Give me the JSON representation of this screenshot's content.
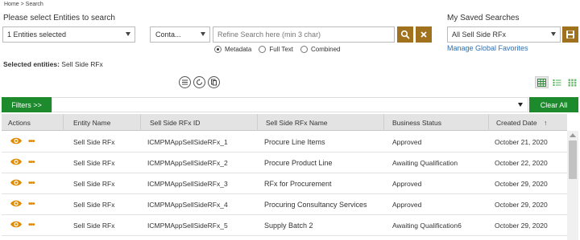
{
  "breadcrumb": "Home > Search",
  "search": {
    "prompt": "Please select Entities to search",
    "entities_value": "1 Entities selected",
    "condition_value": "Conta...",
    "query_placeholder": "Refine Search here (min 3 char)",
    "modes": [
      {
        "label": "Metadata",
        "selected": true
      },
      {
        "label": "Full Text",
        "selected": false
      },
      {
        "label": "Combined",
        "selected": false
      }
    ]
  },
  "saved": {
    "label": "My Saved Searches",
    "value": "All Sell Side RFx",
    "manage_link": "Manage Global Favorites"
  },
  "selected_entities": {
    "label": "Selected entities:",
    "value": "Sell Side RFx"
  },
  "filters": {
    "button_label": "Filters >>",
    "clear_all_label": "Clear All"
  },
  "table": {
    "columns": [
      "Actions",
      "Entity Name",
      "Sell Side RFx ID",
      "Sell Side RFx Name",
      "Business Status",
      "Created Date"
    ],
    "sort_indicator": "↑",
    "rows": [
      {
        "entity": "Sell Side RFx",
        "id": "ICMPMAppSellSideRFx_1",
        "name": "Procure Line Items",
        "status": "Approved",
        "created": "October 21, 2020"
      },
      {
        "entity": "Sell Side RFx",
        "id": "ICMPMAppSellSideRFx_2",
        "name": "Procure Product Line",
        "status": "Awaiting Qualification",
        "created": "October 22, 2020"
      },
      {
        "entity": "Sell Side RFx",
        "id": "ICMPMAppSellSideRFx_3",
        "name": "RFx for Procurement",
        "status": "Approved",
        "created": "October 29, 2020"
      },
      {
        "entity": "Sell Side RFx",
        "id": "ICMPMAppSellSideRFx_4",
        "name": "Procuring Consultancy Services",
        "status": "Approved",
        "created": "October 29, 2020"
      },
      {
        "entity": "Sell Side RFx",
        "id": "ICMPMAppSellSideRFx_5",
        "name": "Supply Batch 2",
        "status": "Awaiting Qualification6",
        "created": "October 29, 2020"
      }
    ]
  },
  "colors": {
    "accent": "#a0721d",
    "green": "#1e8a2e",
    "link": "#2a6fb5",
    "action_icon": "#e08a00"
  }
}
